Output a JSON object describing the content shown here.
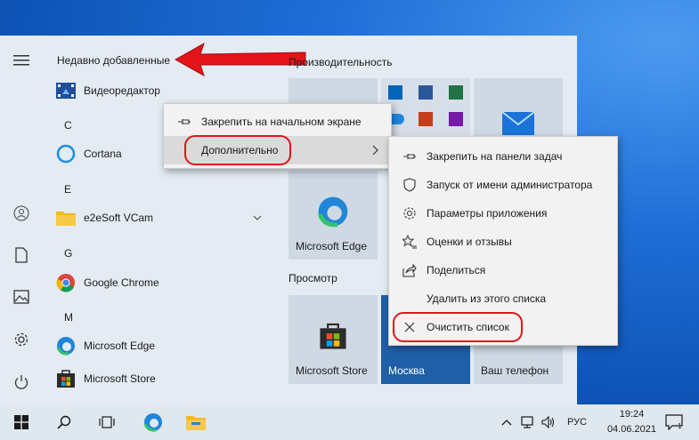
{
  "start_menu": {
    "section_recent": "Недавно добавленные",
    "apps": [
      {
        "label": "Видеоредактор"
      },
      {
        "letter": "C"
      },
      {
        "label": "Cortana"
      },
      {
        "letter": "E"
      },
      {
        "label": "e2eSoft VCam"
      },
      {
        "letter": "G"
      },
      {
        "label": "Google Chrome"
      },
      {
        "letter": "M"
      },
      {
        "label": "Microsoft Edge"
      },
      {
        "label": "Microsoft Store"
      }
    ]
  },
  "tiles": {
    "group_productivity": "Производительность",
    "group_browse": "Просмотр",
    "edge": "Microsoft Edge",
    "store": "Microsoft Store",
    "weather": "Москва",
    "phone": "Ваш телефон"
  },
  "context_menu": {
    "pin_start": "Закрепить на начальном экране",
    "more": "Дополнительно"
  },
  "submenu": {
    "items": [
      "Закрепить на панели задач",
      "Запуск от имени администратора",
      "Параметры приложения",
      "Оценки и отзывы",
      "Поделиться",
      "Удалить из этого списка",
      "Очистить список"
    ]
  },
  "taskbar": {
    "language": "РУС",
    "time": "19:24",
    "date": "04.06.2021",
    "notification_count": "1"
  },
  "colors": {
    "highlight": "#e3141a",
    "accent": "#0078d7"
  }
}
